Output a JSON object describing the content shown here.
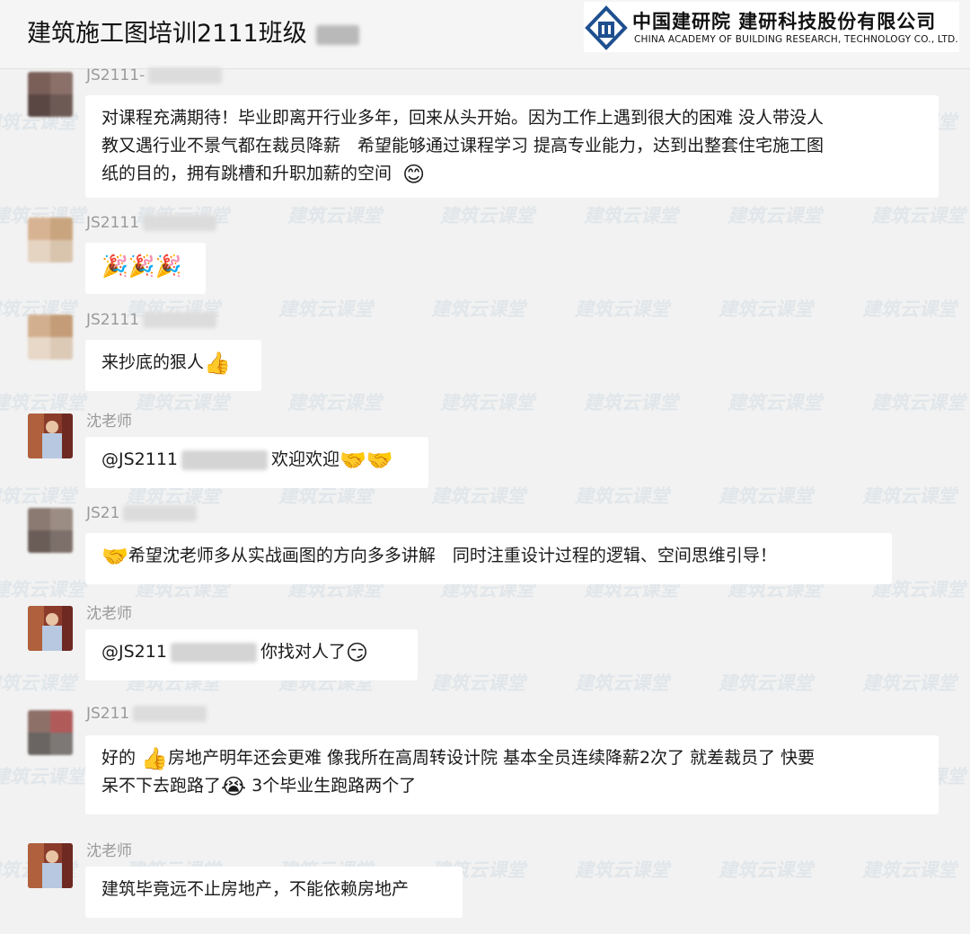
{
  "header": {
    "chat_title": "建筑施工图培训2111班级",
    "logo_cn": "中国建研院 建研科技股份有限公司",
    "logo_en": "CHINA ACADEMY OF BUILDING RESEARCH, TECHNOLOGY CO., LTD."
  },
  "watermark": "建筑云课堂",
  "messages": [
    {
      "sender": "JS2111-",
      "lines": [
        "对课程充满期待！毕业即离开行业多年，回来从头开始。因为工作上遇到很大的困难 没人带没人",
        "教又遇行业不景气都在裁员降薪　希望能够通过课程学习  提高专业能力，达到出整套住宅施工图",
        "纸的目的，拥有跳槽和升职加薪的空间"
      ],
      "emoji": "😊"
    },
    {
      "sender": "JS2111",
      "emoji": "🎉🎉🎉"
    },
    {
      "sender": "JS2111",
      "text": "来抄底的狠人",
      "emoji": "👍"
    },
    {
      "sender": "沈老师",
      "mention": "@JS2111",
      "text": "欢迎欢迎",
      "emoji": "🤝🤝"
    },
    {
      "sender": "JS21",
      "emoji": "🤝",
      "text": "希望沈老师多从实战画图的方向多多讲解　同时注重设计过程的逻辑、空间思维引导！"
    },
    {
      "sender": "沈老师",
      "mention": "@JS211",
      "text": "你找对人了",
      "emoji": "😏"
    },
    {
      "sender": "JS211",
      "line1_a": "好的 ",
      "emoji1": "👍",
      "line1_b": "房地产明年还会更难  像我所在高周转设计院  基本全员连续降薪2次了   就差裁员了 快要",
      "line2_a": "呆不下去跑路了",
      "emoji2": "😭",
      "line2_b": " 3个毕业生跑路两个了"
    },
    {
      "sender": "沈老师",
      "text": "建筑毕竟远不止房地产，不能依赖房地产"
    }
  ]
}
